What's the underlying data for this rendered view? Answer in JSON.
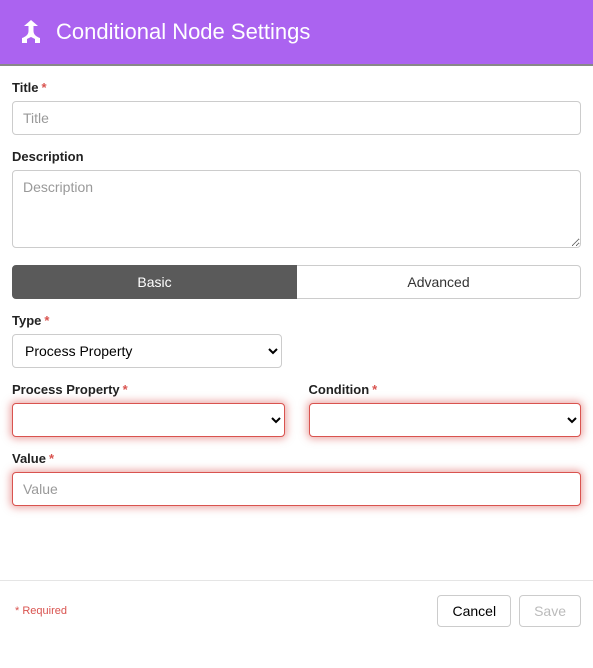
{
  "header": {
    "title": "Conditional Node Settings"
  },
  "fields": {
    "title": {
      "label": "Title",
      "placeholder": "Title",
      "required": true
    },
    "description": {
      "label": "Description",
      "placeholder": "Description",
      "required": false
    },
    "type": {
      "label": "Type",
      "selected": "Process Property",
      "required": true
    },
    "processProperty": {
      "label": "Process Property",
      "required": true
    },
    "condition": {
      "label": "Condition",
      "required": true
    },
    "value": {
      "label": "Value",
      "placeholder": "Value",
      "required": true
    }
  },
  "tabs": {
    "basic": "Basic",
    "advanced": "Advanced"
  },
  "footer": {
    "requiredNote": "Required",
    "cancel": "Cancel",
    "save": "Save"
  }
}
